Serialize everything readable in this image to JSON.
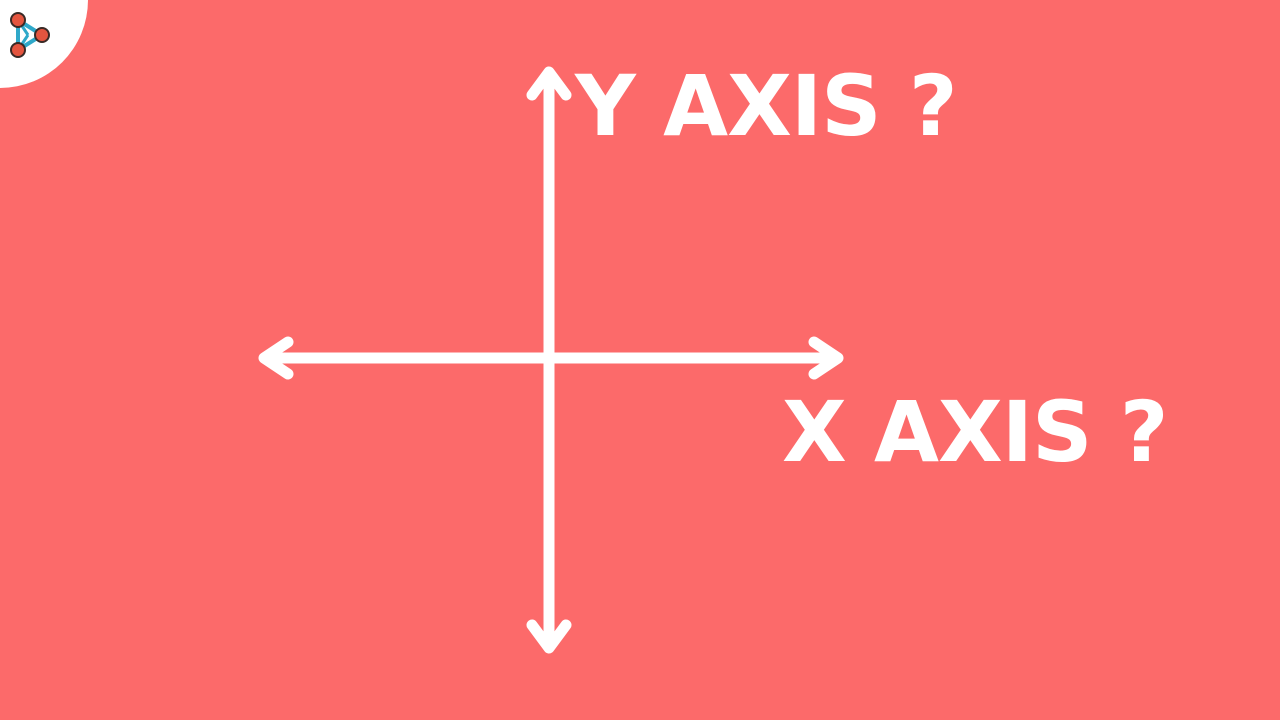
{
  "labels": {
    "y_axis": "Y AXIS ?",
    "x_axis": "X AXIS ?"
  },
  "colors": {
    "background": "#fc6a6a",
    "foreground": "#ffffff",
    "logo_nodes": "#e4553f",
    "logo_edges": "#2fa8c9"
  },
  "icons": {
    "logo": "channel-logo-icon",
    "axes": "cartesian-axes-icon"
  }
}
